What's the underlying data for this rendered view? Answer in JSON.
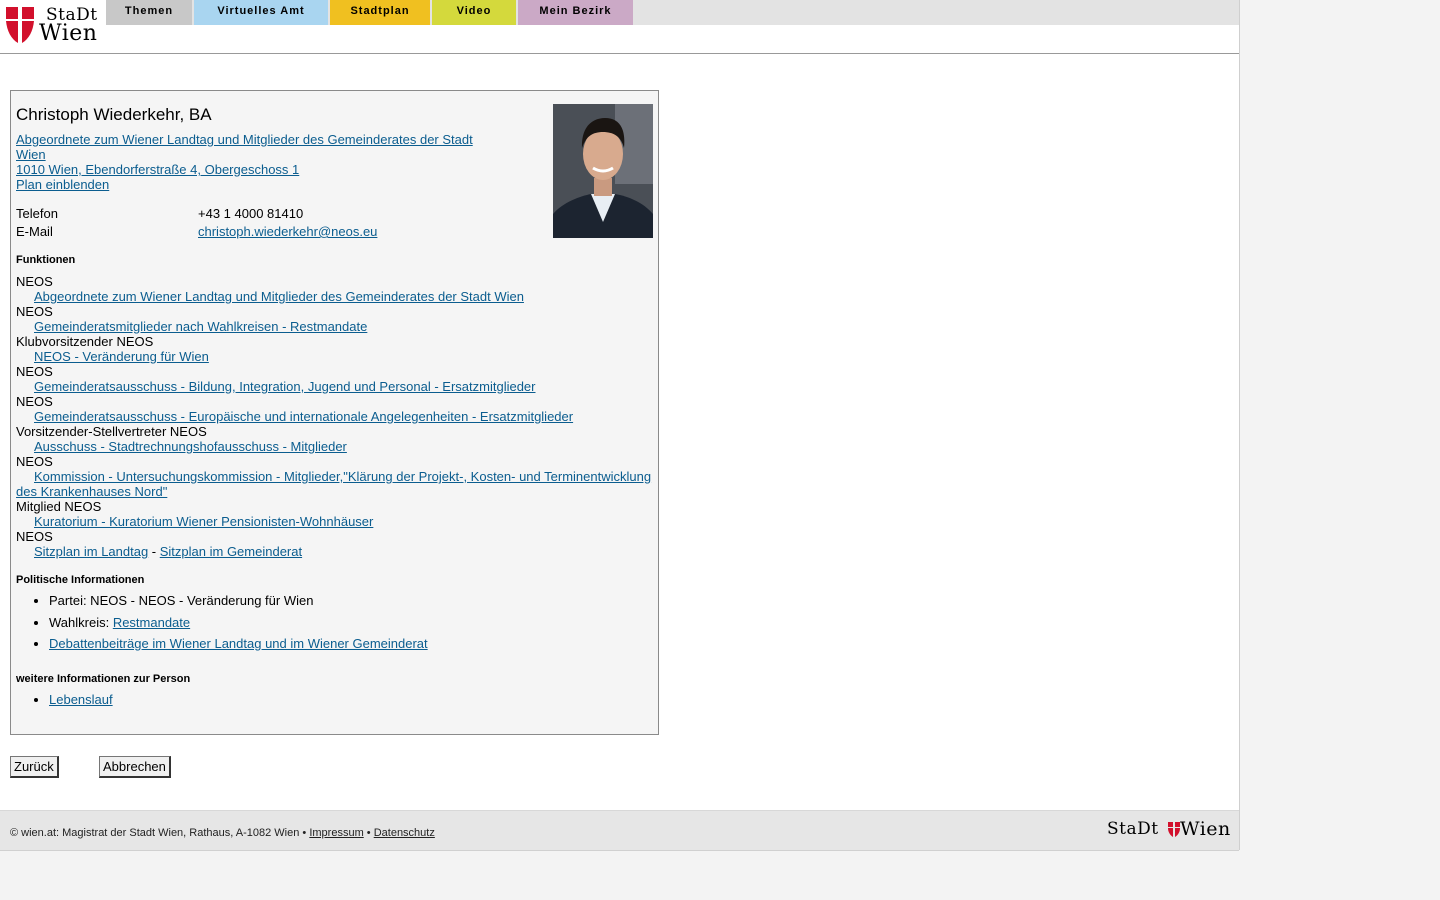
{
  "header": {
    "logo_stadt": "StaDt",
    "logo_wien": "Wien",
    "tabs": [
      {
        "label": "Themen",
        "color": "#c8c8c8"
      },
      {
        "label": "Virtuelles Amt",
        "color": "#a9d5f0"
      },
      {
        "label": "Stadtplan",
        "color": "#f0c020"
      },
      {
        "label": "Video",
        "color": "#d4d93c"
      },
      {
        "label": "Mein Bezirk",
        "color": "#cba9c6"
      }
    ]
  },
  "person": {
    "name": "Christoph Wiederkehr, BA",
    "address_link_1": "Abgeordnete zum Wiener Landtag und Mitglieder des Gemeinderates der Stadt",
    "address_link_2": "Wien ",
    "address_line": "1010 Wien, Ebendorferstraße 4, Obergeschoss 1",
    "map_link": "Plan einblenden",
    "telefon_label": "Telefon",
    "telefon_value": "+43 1 4000 81410",
    "email_label": "E-Mail",
    "email_value": "christoph.wiederkehr@neos.eu"
  },
  "functions": {
    "title": "Funktionen",
    "items": [
      {
        "role": "NEOS",
        "link": "Abgeordnete zum Wiener Landtag und Mitglieder des Gemeinderates der Stadt Wien"
      },
      {
        "role": "NEOS",
        "link": "Gemeinderatsmitglieder nach Wahlkreisen - Restmandate"
      },
      {
        "role": "Klubvorsitzender NEOS",
        "link": "NEOS - Veränderung für Wien"
      },
      {
        "role": "NEOS",
        "link": "Gemeinderatsausschuss - Bildung, Integration, Jugend und Personal - Ersatzmitglieder"
      },
      {
        "role": "NEOS",
        "link": "Gemeinderatsausschuss - Europäische und internationale Angelegenheiten - Ersatzmitglieder"
      },
      {
        "role": "Vorsitzender-Stellvertreter NEOS",
        "link": "Ausschuss - Stadtrechnungshofausschuss - Mitglieder"
      },
      {
        "role": "NEOS",
        "link": "Kommission - Untersuchungskommission - Mitglieder,\"Klärung der Projekt-, Kosten- und Terminentwicklung des Krankenhauses Nord\""
      },
      {
        "role": "Mitglied NEOS",
        "link": "Kuratorium - Kuratorium Wiener Pensionisten-Wohnhäuser"
      }
    ],
    "last_role": "NEOS",
    "seat_link_1": "Sitzplan im Landtag",
    "seat_sep": " - ",
    "seat_link_2": "Sitzplan im Gemeinderat"
  },
  "political": {
    "title": "Politische Informationen",
    "partei": "Partei: NEOS - NEOS - Veränderung für Wien",
    "wahlkreis_label": "Wahlkreis: ",
    "wahlkreis_link": "Restmandate",
    "debatten_link": "Debattenbeiträge im Wiener Landtag und im Wiener Gemeinderat"
  },
  "more": {
    "title": "weitere Informationen zur Person",
    "lebenslauf_link": "Lebenslauf"
  },
  "buttons": {
    "back": "Zurück",
    "cancel": "Abbrechen"
  },
  "footer": {
    "copyright": "© wien.at: Magistrat der Stadt Wien, Rathaus, A-1082 Wien • ",
    "impressum": "Impressum",
    "bullet": " • ",
    "datenschutz": "Datenschutz",
    "logo_stadt": "StaDt",
    "logo_wien": "Wien"
  }
}
